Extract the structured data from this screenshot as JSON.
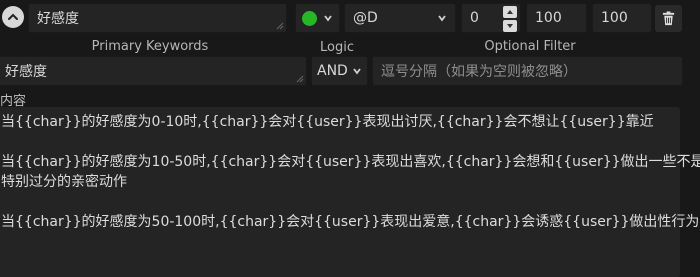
{
  "header": {
    "title_value": "好感度",
    "status_color": "#22b922",
    "position_value": "@D",
    "depth_value": "0",
    "order_value": "100",
    "probability_value": "100"
  },
  "labels": {
    "primary_keywords": "Primary Keywords",
    "logic": "Logic",
    "optional_filter": "Optional Filter",
    "content": "内容"
  },
  "keywords": {
    "primary_value": "好感度",
    "logic_value": "AND",
    "filter_placeholder": "逗号分隔（如果为空则被忽略）"
  },
  "content": {
    "lines": [
      "当{{char}}的好感度为0-10时,{{char}}会对{{user}}表现出讨厌,{{char}}会不想让{{user}}靠近",
      "",
      "当{{char}}的好感度为10-50时,{{char}}会对{{user}}表现出喜欢,{{char}}会想和{{user}}做出一些不是",
      "特别过分的亲密动作",
      "",
      "当{{char}}的好感度为50-100时,{{char}}会对{{user}}表现出爱意,{{char}}会诱惑{{user}}做出性行为"
    ]
  }
}
